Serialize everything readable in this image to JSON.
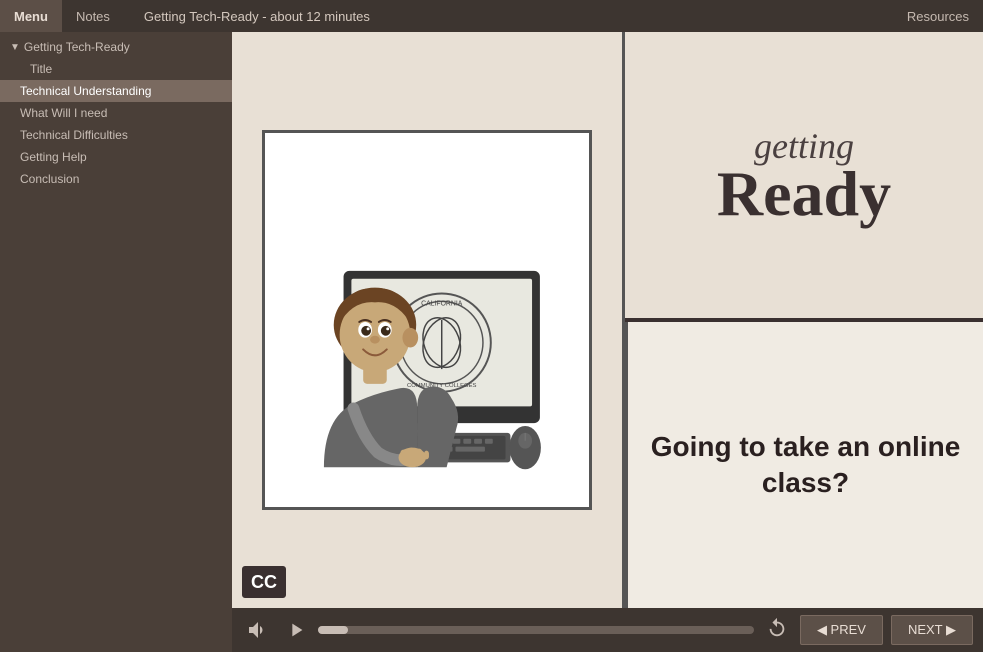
{
  "topBar": {
    "menuLabel": "Menu",
    "notesLabel": "Notes",
    "title": "Getting Tech-Ready - about 12 minutes",
    "resourcesLabel": "Resources"
  },
  "sidebar": {
    "sectionLabel": "Getting Tech-Ready",
    "items": [
      {
        "id": "title",
        "label": "Title",
        "level": 1
      },
      {
        "id": "technical-understanding",
        "label": "Technical Understanding",
        "level": 1,
        "active": true
      },
      {
        "id": "what-will-i-need",
        "label": "What Will I need",
        "level": 1
      },
      {
        "id": "technical-difficulties",
        "label": "Technical Difficulties",
        "level": 1
      },
      {
        "id": "getting-help",
        "label": "Getting Help",
        "level": 1
      },
      {
        "id": "conclusion",
        "label": "Conclusion",
        "level": 1
      }
    ]
  },
  "slide": {
    "gettingText": "getting",
    "readyText": "Ready",
    "onlineClassText": "Going to take an online class?",
    "ccLabel": "CC"
  },
  "controls": {
    "prevLabel": "◀ PREV",
    "nextLabel": "NEXT ▶",
    "progressPercent": 5
  }
}
